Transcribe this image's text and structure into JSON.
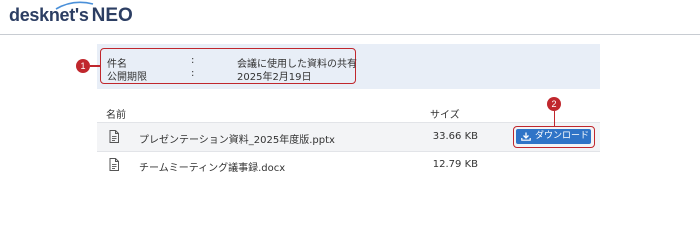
{
  "header": {
    "logo_word": "desknet's",
    "logo_neo": "NEO"
  },
  "info": {
    "rows": [
      {
        "key": "件名",
        "colon": ":",
        "value": "会議に使用した資料の共有"
      },
      {
        "key": "公開期限",
        "colon": ":",
        "value": "2025年2月19日"
      }
    ]
  },
  "annotations": {
    "badge1": "1",
    "badge2": "2"
  },
  "table": {
    "headers": {
      "name": "名前",
      "size": "サイズ"
    },
    "rows": [
      {
        "name": "プレゼンテーション資料_2025年度版.pptx",
        "size": "33.66 KB"
      },
      {
        "name": "チームミーティング議事録.docx",
        "size": "12.79 KB"
      }
    ]
  },
  "download_button": {
    "label": "ダウンロード"
  },
  "colors": {
    "accent": "#2f74c7",
    "annotation_red": "#c0272d",
    "info_bg": "#e8eef7",
    "logo": "#2c3e63"
  }
}
